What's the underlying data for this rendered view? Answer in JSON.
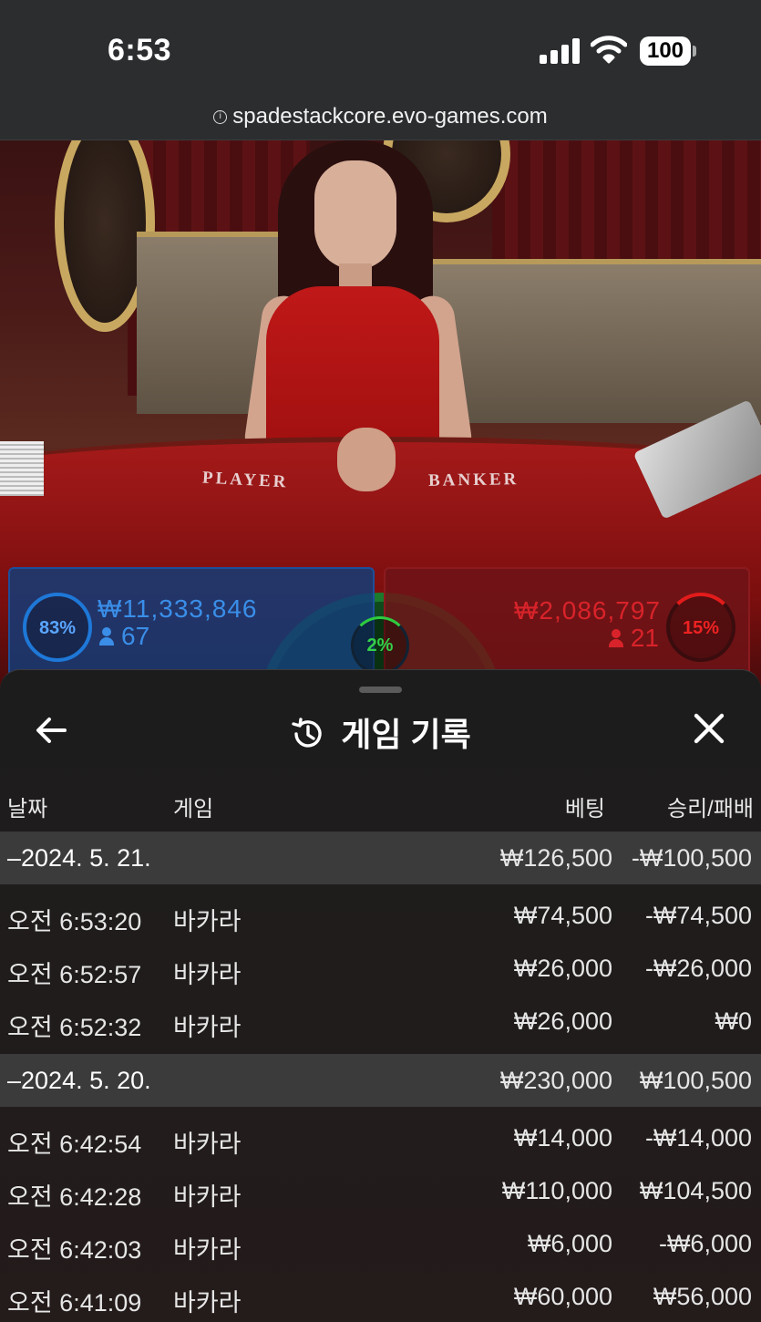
{
  "status_bar": {
    "time": "6:53",
    "battery": "100"
  },
  "browser": {
    "url": "spadestackcore.evo-games.com"
  },
  "video": {
    "table_player_label": "PLAYER",
    "table_banker_label": "BANKER"
  },
  "bets": {
    "player": {
      "percent_label": "83%",
      "percent_value": 0.83,
      "amount": "₩11,333,846",
      "players": "67",
      "color": "#3a8ee8"
    },
    "tie": {
      "percent_label": "2%",
      "percent_value": 0.02,
      "color": "#35d04a"
    },
    "banker": {
      "percent_label": "15%",
      "percent_value": 0.15,
      "amount": "₩2,086,797",
      "players": "21",
      "color": "#d9232a"
    }
  },
  "sheet": {
    "title": "게임 기록",
    "icons": {
      "back": "arrow-left-icon",
      "history": "history-icon",
      "close": "close-icon"
    },
    "columns": {
      "date": "날짜",
      "game": "게임",
      "bet": "베팅",
      "win_loss": "승리/패배"
    },
    "groups": [
      {
        "date": "–2024. 5. 21.",
        "bet": "₩126,500",
        "win_loss": "-₩100,500",
        "rows": [
          {
            "time": "오전 6:53:20",
            "game": "바카라",
            "bet": "₩74,500",
            "win_loss": "-₩74,500"
          },
          {
            "time": "오전 6:52:57",
            "game": "바카라",
            "bet": "₩26,000",
            "win_loss": "-₩26,000"
          },
          {
            "time": "오전 6:52:32",
            "game": "바카라",
            "bet": "₩26,000",
            "win_loss": "₩0"
          }
        ]
      },
      {
        "date": "–2024. 5. 20.",
        "bet": "₩230,000",
        "win_loss": "₩100,500",
        "rows": [
          {
            "time": "오전 6:42:54",
            "game": "바카라",
            "bet": "₩14,000",
            "win_loss": "-₩14,000"
          },
          {
            "time": "오전 6:42:28",
            "game": "바카라",
            "bet": "₩110,000",
            "win_loss": "₩104,500"
          },
          {
            "time": "오전 6:42:03",
            "game": "바카라",
            "bet": "₩6,000",
            "win_loss": "-₩6,000"
          },
          {
            "time": "오전 6:41:09",
            "game": "바카라",
            "bet": "₩60,000",
            "win_loss": "₩56,000"
          }
        ]
      }
    ]
  }
}
